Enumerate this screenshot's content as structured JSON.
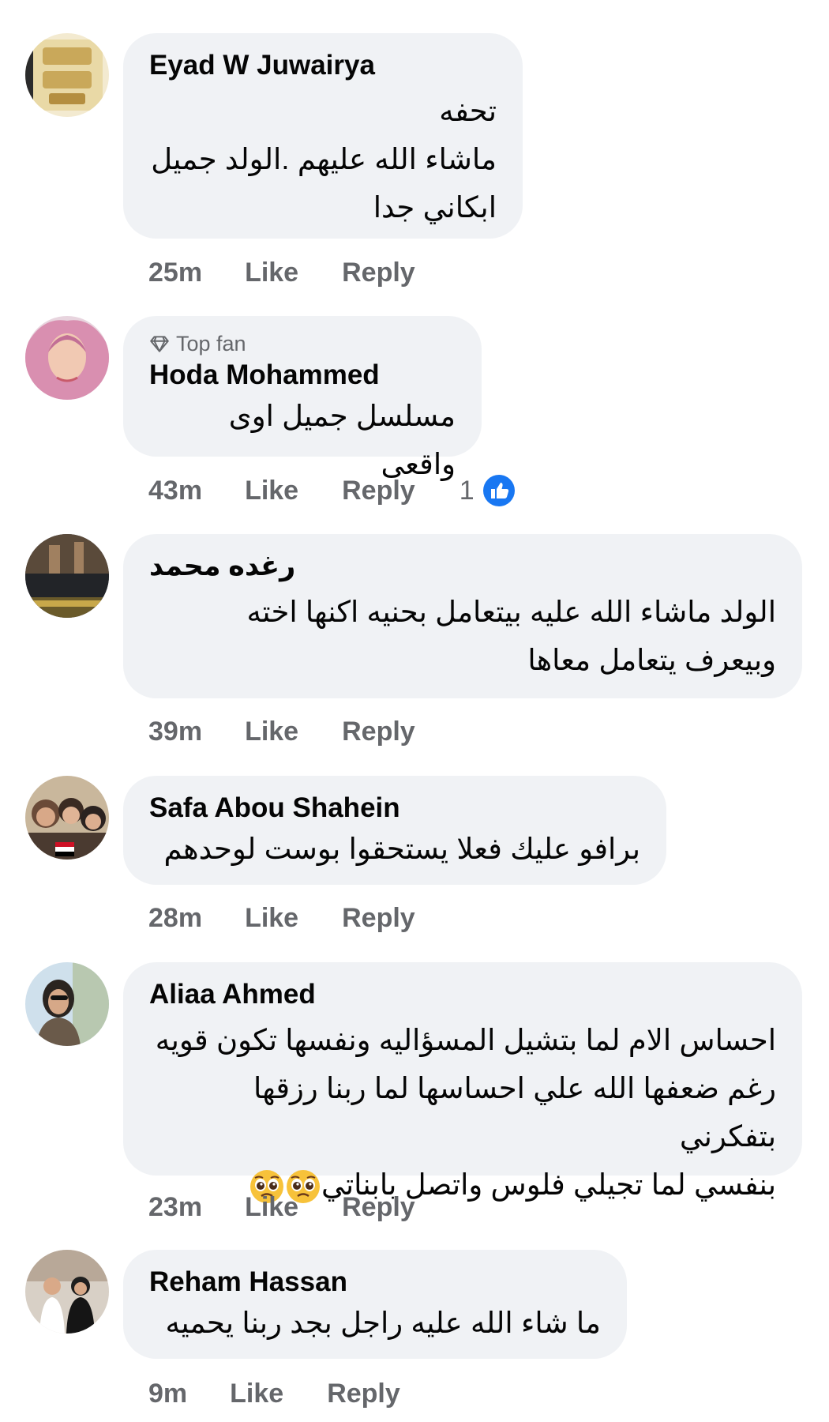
{
  "comments": [
    {
      "author": "Eyad W Juwairya",
      "badge": "",
      "text": "تحفه\nماشاء الله عليهم .الولد جميل\nابكاني جدا",
      "time": "25m",
      "like_label": "Like",
      "reply_label": "Reply"
    },
    {
      "author": "Hoda Mohammed",
      "badge": "Top fan",
      "text": "مسلسل جميل اوى واقعى",
      "time": "43m",
      "like_label": "Like",
      "reply_label": "Reply",
      "reaction_count": "1"
    },
    {
      "author": "رغده محمد",
      "badge": "",
      "text": "الولد ماشاء الله عليه بيتعامل بحنيه اكنها اخته\nوبيعرف يتعامل معاها",
      "time": "39m",
      "like_label": "Like",
      "reply_label": "Reply"
    },
    {
      "author": "Safa Abou Shahein",
      "badge": "",
      "text": "برافو عليك فعلا يستحقوا بوست لوحدهم",
      "time": "28m",
      "like_label": "Like",
      "reply_label": "Reply"
    },
    {
      "author": "Aliaa Ahmed",
      "badge": "",
      "text_lines": [
        "احساس الام لما بتشيل المسؤاليه ونفسها تكون قويه",
        "رغم ضعفها الله علي احساسها لما ربنا رزقها بتفكرني",
        "بنفسي لما تجيلي فلوس واتصل بابناتي"
      ],
      "emoji": "pleading-face-emoji",
      "time": "23m",
      "like_label": "Like",
      "reply_label": "Reply"
    },
    {
      "author": "Reham Hassan",
      "badge": "",
      "text": "ما شاء الله عليه راجل بجد ربنا يحميه",
      "time": "9m",
      "like_label": "Like",
      "reply_label": "Reply"
    }
  ],
  "colors": {
    "bubble_bg": "#f0f2f5",
    "meta_text": "#65676b",
    "like_blue": "#1877f2"
  }
}
